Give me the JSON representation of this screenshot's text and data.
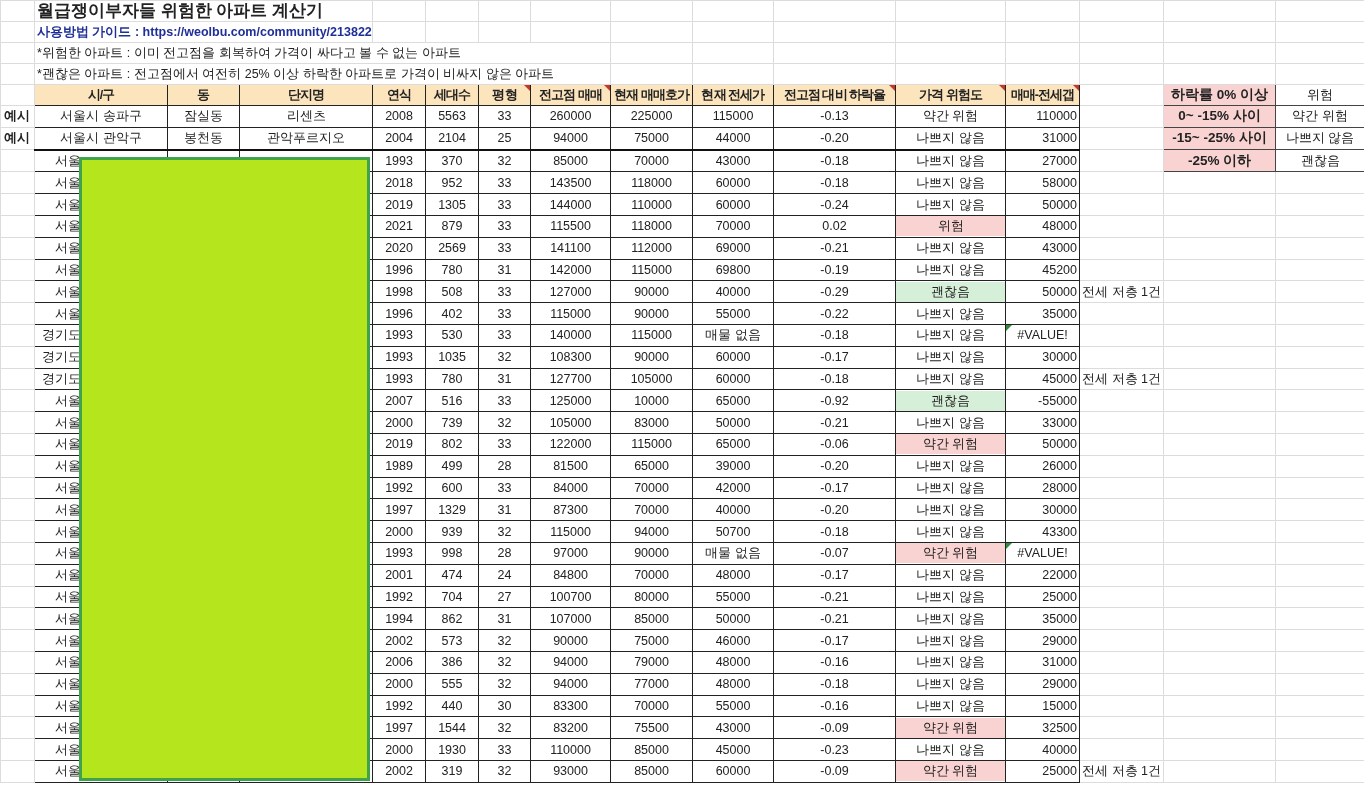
{
  "title": "월급쟁이부자들 위험한 아파트 계산기",
  "guide": "사용방법 가이드 : https://weolbu.com/community/213822",
  "notes": [
    "*위험한 아파트 : 이미 전고점을 회복하여 가격이 싸다고 볼 수 없는 아파트",
    "*괜찮은 아파트 : 전고점에서 여전히 25% 이상 하락한 아파트로 가격이 비싸지 않은 아파트"
  ],
  "columns": [
    {
      "label": "시/구",
      "comment": false
    },
    {
      "label": "동",
      "comment": false
    },
    {
      "label": "단지명",
      "comment": false
    },
    {
      "label": "연식",
      "comment": false
    },
    {
      "label": "세대수",
      "comment": false
    },
    {
      "label": "평형",
      "comment": true
    },
    {
      "label": "전고점 매매",
      "comment": true
    },
    {
      "label": "현재 매매호가",
      "comment": false
    },
    {
      "label": "현재 전세가",
      "comment": false
    },
    {
      "label": "전고점 대비 하락율",
      "comment": true
    },
    {
      "label": "가격 위험도",
      "comment": true
    },
    {
      "label": "매매-전세갭",
      "comment": true
    }
  ],
  "rows": [
    {
      "label": "예시",
      "city": "서울시 송파구",
      "dong": "잠실동",
      "complex": "리센츠",
      "year": "2008",
      "units": "5563",
      "size": "33",
      "peak": "260000",
      "price": "225000",
      "jeonse": "115000",
      "drop": "-0.13",
      "risk": "약간 위험",
      "gap": "110000",
      "gap_error": false
    },
    {
      "label": "예시",
      "city": "서울시 관악구",
      "dong": "봉천동",
      "complex": "관악푸르지오",
      "year": "2004",
      "units": "2104",
      "size": "25",
      "peak": "94000",
      "price": "75000",
      "jeonse": "44000",
      "drop": "-0.20",
      "risk": "나쁘지 않음",
      "gap": "31000",
      "gap_error": false
    },
    {
      "city": "서울",
      "year": "1993",
      "units": "370",
      "size": "32",
      "peak": "85000",
      "price": "70000",
      "jeonse": "43000",
      "drop": "-0.18",
      "risk": "나쁘지 않음",
      "gap": "27000",
      "gap_error": false
    },
    {
      "city": "서울",
      "year": "2018",
      "units": "952",
      "size": "33",
      "peak": "143500",
      "price": "118000",
      "jeonse": "60000",
      "drop": "-0.18",
      "risk": "나쁘지 않음",
      "gap": "58000",
      "gap_error": false
    },
    {
      "city": "서울",
      "year": "2019",
      "units": "1305",
      "size": "33",
      "peak": "144000",
      "price": "110000",
      "jeonse": "60000",
      "drop": "-0.24",
      "risk": "나쁘지 않음",
      "gap": "50000",
      "gap_error": false
    },
    {
      "city": "서울",
      "year": "2021",
      "units": "879",
      "size": "33",
      "peak": "115500",
      "price": "118000",
      "jeonse": "70000",
      "drop": "0.02",
      "risk": "위험",
      "color": "#f8d3d1",
      "gap": "48000",
      "gap_error": false
    },
    {
      "city": "서울",
      "year": "2020",
      "units": "2569",
      "size": "33",
      "peak": "141100",
      "price": "112000",
      "jeonse": "69000",
      "drop": "-0.21",
      "risk": "나쁘지 않음",
      "gap": "43000",
      "gap_error": false
    },
    {
      "city": "서울",
      "year": "1996",
      "units": "780",
      "size": "31",
      "peak": "142000",
      "price": "115000",
      "jeonse": "69800",
      "drop": "-0.19",
      "risk": "나쁘지 않음",
      "gap": "45200",
      "gap_error": false
    },
    {
      "city": "서울",
      "year": "1998",
      "units": "508",
      "size": "33",
      "peak": "127000",
      "price": "90000",
      "jeonse": "40000",
      "drop": "-0.29",
      "risk": "괜찮음",
      "color": "#d6efd8",
      "gap": "50000",
      "gap_error": false,
      "note": "전세 저층 1건"
    },
    {
      "city": "서울",
      "year": "1996",
      "units": "402",
      "size": "33",
      "peak": "115000",
      "price": "90000",
      "jeonse": "55000",
      "drop": "-0.22",
      "risk": "나쁘지 않음",
      "gap": "35000",
      "gap_error": false
    },
    {
      "city": "경기도",
      "year": "1993",
      "units": "530",
      "size": "33",
      "peak": "140000",
      "price": "115000",
      "jeonse": "매물 없음",
      "drop": "-0.18",
      "risk": "나쁘지 않음",
      "gap": "#VALUE!",
      "gap_error": true
    },
    {
      "city": "경기도",
      "year": "1993",
      "units": "1035",
      "size": "32",
      "peak": "108300",
      "price": "90000",
      "jeonse": "60000",
      "drop": "-0.17",
      "risk": "나쁘지 않음",
      "gap": "30000",
      "gap_error": false
    },
    {
      "city": "경기도",
      "year": "1993",
      "units": "780",
      "size": "31",
      "peak": "127700",
      "price": "105000",
      "jeonse": "60000",
      "drop": "-0.18",
      "risk": "나쁘지 않음",
      "gap": "45000",
      "gap_error": false,
      "note": "전세 저층 1건"
    },
    {
      "city": "서울",
      "year": "2007",
      "units": "516",
      "size": "33",
      "peak": "125000",
      "price": "10000",
      "jeonse": "65000",
      "drop": "-0.92",
      "risk": "괜찮음",
      "color": "#d6efd8",
      "gap": "-55000",
      "gap_error": false
    },
    {
      "city": "서울",
      "year": "2000",
      "units": "739",
      "size": "32",
      "peak": "105000",
      "price": "83000",
      "jeonse": "50000",
      "drop": "-0.21",
      "risk": "나쁘지 않음",
      "gap": "33000",
      "gap_error": false
    },
    {
      "city": "서울",
      "year": "2019",
      "units": "802",
      "size": "33",
      "peak": "122000",
      "price": "115000",
      "jeonse": "65000",
      "drop": "-0.06",
      "risk": "약간 위험",
      "color": "#f8d3d1",
      "gap": "50000",
      "gap_error": false
    },
    {
      "city": "서울",
      "year": "1989",
      "units": "499",
      "size": "28",
      "peak": "81500",
      "price": "65000",
      "jeonse": "39000",
      "drop": "-0.20",
      "risk": "나쁘지 않음",
      "gap": "26000",
      "gap_error": false
    },
    {
      "city": "서울",
      "year": "1992",
      "units": "600",
      "size": "33",
      "peak": "84000",
      "price": "70000",
      "jeonse": "42000",
      "drop": "-0.17",
      "risk": "나쁘지 않음",
      "gap": "28000",
      "gap_error": false
    },
    {
      "city": "서울",
      "year": "1997",
      "units": "1329",
      "size": "31",
      "peak": "87300",
      "price": "70000",
      "jeonse": "40000",
      "drop": "-0.20",
      "risk": "나쁘지 않음",
      "gap": "30000",
      "gap_error": false
    },
    {
      "city": "서울",
      "year": "2000",
      "units": "939",
      "size": "32",
      "peak": "115000",
      "price": "94000",
      "jeonse": "50700",
      "drop": "-0.18",
      "risk": "나쁘지 않음",
      "gap": "43300",
      "gap_error": false
    },
    {
      "city": "서울",
      "year": "1993",
      "units": "998",
      "size": "28",
      "peak": "97000",
      "price": "90000",
      "jeonse": "매물 없음",
      "drop": "-0.07",
      "risk": "약간 위험",
      "color": "#f8d3d1",
      "gap": "#VALUE!",
      "gap_error": true
    },
    {
      "city": "서울",
      "year": "2001",
      "units": "474",
      "size": "24",
      "peak": "84800",
      "price": "70000",
      "jeonse": "48000",
      "drop": "-0.17",
      "risk": "나쁘지 않음",
      "gap": "22000",
      "gap_error": false
    },
    {
      "city": "서울",
      "year": "1992",
      "units": "704",
      "size": "27",
      "peak": "100700",
      "price": "80000",
      "jeonse": "55000",
      "drop": "-0.21",
      "risk": "나쁘지 않음",
      "gap": "25000",
      "gap_error": false
    },
    {
      "city": "서울",
      "year": "1994",
      "units": "862",
      "size": "31",
      "peak": "107000",
      "price": "85000",
      "jeonse": "50000",
      "drop": "-0.21",
      "risk": "나쁘지 않음",
      "gap": "35000",
      "gap_error": false
    },
    {
      "city": "서울",
      "year": "2002",
      "units": "573",
      "size": "32",
      "peak": "90000",
      "price": "75000",
      "jeonse": "46000",
      "drop": "-0.17",
      "risk": "나쁘지 않음",
      "gap": "29000",
      "gap_error": false
    },
    {
      "city": "서울",
      "year": "2006",
      "units": "386",
      "size": "32",
      "peak": "94000",
      "price": "79000",
      "jeonse": "48000",
      "drop": "-0.16",
      "risk": "나쁘지 않음",
      "gap": "31000",
      "gap_error": false
    },
    {
      "city": "서울",
      "year": "2000",
      "units": "555",
      "size": "32",
      "peak": "94000",
      "price": "77000",
      "jeonse": "48000",
      "drop": "-0.18",
      "risk": "나쁘지 않음",
      "gap": "29000",
      "gap_error": false
    },
    {
      "city": "서울",
      "year": "1992",
      "units": "440",
      "size": "30",
      "peak": "83300",
      "price": "70000",
      "jeonse": "55000",
      "drop": "-0.16",
      "risk": "나쁘지 않음",
      "gap": "15000",
      "gap_error": false
    },
    {
      "city": "서울",
      "year": "1997",
      "units": "1544",
      "size": "32",
      "peak": "83200",
      "price": "75500",
      "jeonse": "43000",
      "drop": "-0.09",
      "risk": "약간 위험",
      "color": "#f8d3d1",
      "gap": "32500",
      "gap_error": false
    },
    {
      "city": "서울",
      "year": "2000",
      "units": "1930",
      "size": "33",
      "peak": "110000",
      "price": "85000",
      "jeonse": "45000",
      "drop": "-0.23",
      "risk": "나쁘지 않음",
      "gap": "40000",
      "gap_error": false
    },
    {
      "city": "서울",
      "year": "2002",
      "units": "319",
      "size": "32",
      "peak": "93000",
      "price": "85000",
      "jeonse": "60000",
      "drop": "-0.09",
      "risk": "약간 위험",
      "color": "#f8d3d1",
      "gap": "25000",
      "gap_error": false,
      "note": "전세 저층 1건"
    }
  ],
  "legend": [
    {
      "range": "하락률 0% 이상",
      "rating": "위험"
    },
    {
      "range": "0~ -15% 사이",
      "rating": "약간 위험"
    },
    {
      "range": "-15~ -25% 사이",
      "rating": "나쁘지 않음"
    },
    {
      "range": "-25% 이하",
      "rating": "괜찮음"
    }
  ]
}
